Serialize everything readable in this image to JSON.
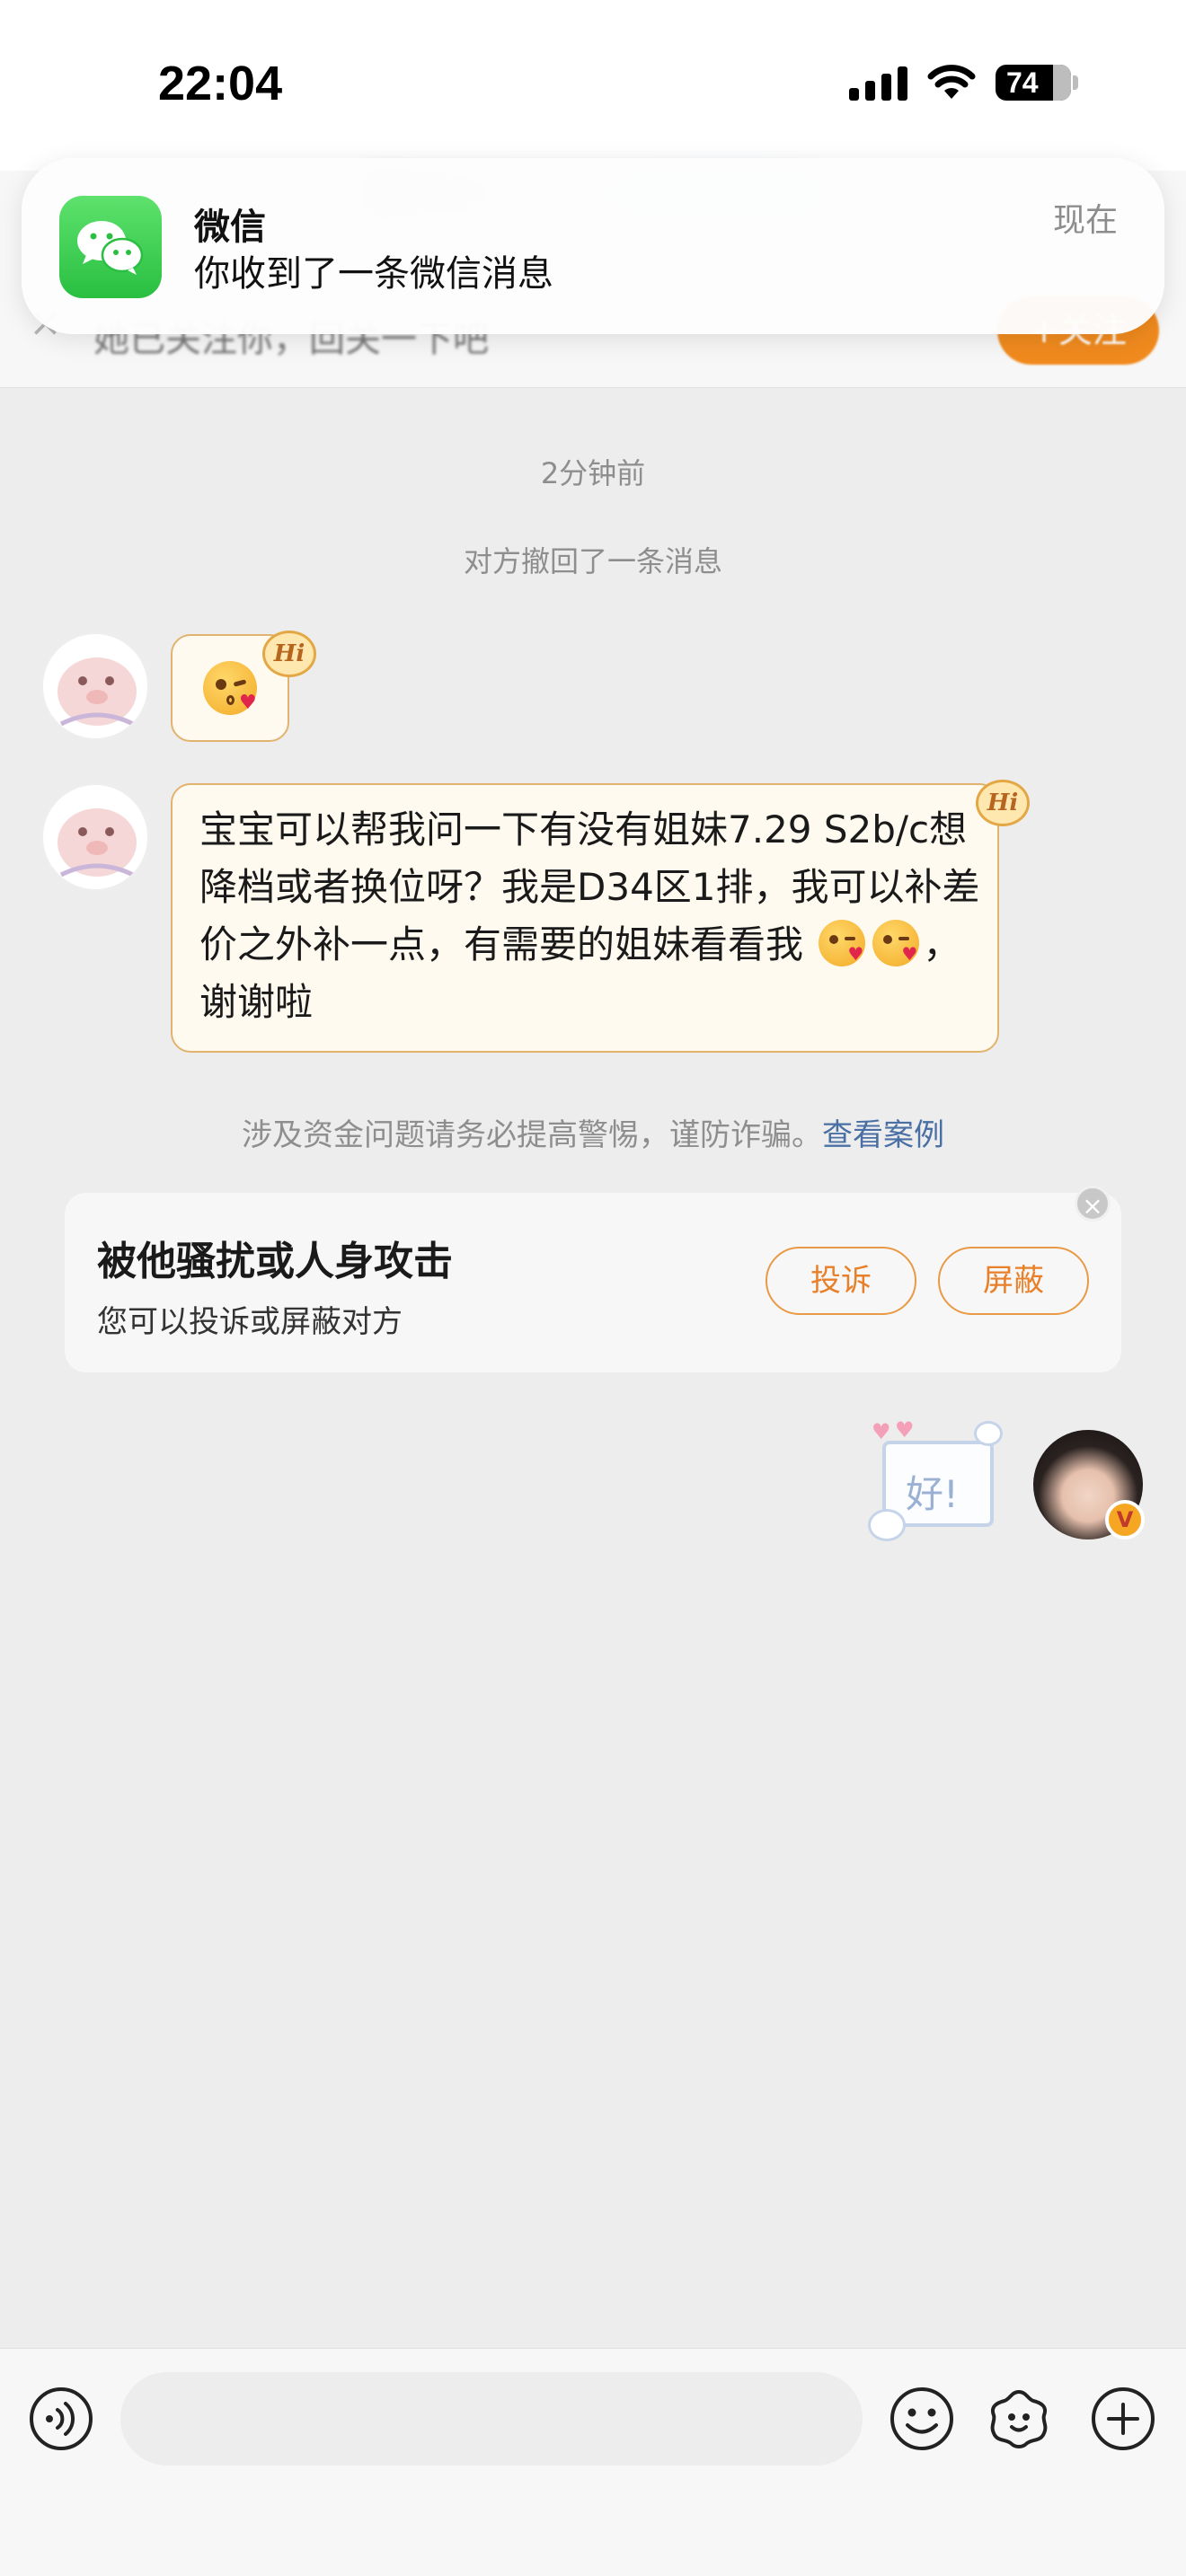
{
  "status_bar": {
    "time": "22:04",
    "battery": "74"
  },
  "banner": {
    "text": "她已关注你，回关一下吧",
    "follow_label": "+关注"
  },
  "notification": {
    "app": "微信",
    "message": "你收到了一条微信消息",
    "time": "现在"
  },
  "chat": {
    "timestamp": "2分钟前",
    "recall_note": "对方撤回了一条消息",
    "hi_badge": "Hi",
    "message": {
      "text_1": "宝宝可以帮我问一下有没有姐妹7.29 S2b/c想降档或者换位呀？我是D34区1排，我可以补差价之外补一点，有需要的姐妹看看我",
      "text_2": "，谢谢啦"
    },
    "warning": {
      "text": "涉及资金问题请务必提高警惕，谨防诈骗。",
      "link": "查看案例"
    },
    "report_card": {
      "title": "被他骚扰或人身攻击",
      "subtitle": "您可以投诉或屏蔽对方",
      "complain_label": "投诉",
      "block_label": "屏蔽"
    },
    "my_sticker_text": "好!"
  },
  "input_bar": {
    "placeholder": ""
  },
  "colors": {
    "accent": "#e8802a",
    "bubble_border": "#e2b36e",
    "link": "#4a6fa5",
    "wechat_green": "#29bf41"
  },
  "icons": [
    "signal-icon",
    "wifi-icon",
    "battery-icon",
    "wechat-icon",
    "close-icon",
    "voice-icon",
    "emoji-icon",
    "sticker-icon",
    "plus-icon"
  ]
}
